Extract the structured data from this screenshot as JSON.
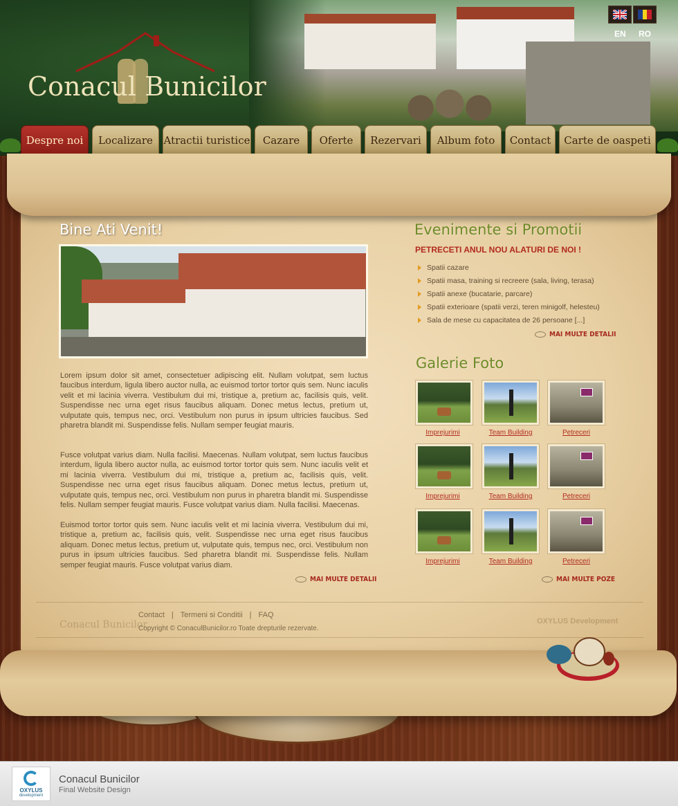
{
  "site": {
    "logo_text": "Conacul Bunicilor"
  },
  "languages": [
    {
      "code": "EN",
      "flag": "uk-flag-icon"
    },
    {
      "code": "RO",
      "flag": "romania-flag-icon"
    }
  ],
  "nav": {
    "items": [
      {
        "label": "Despre noi",
        "active": true
      },
      {
        "label": "Localizare",
        "active": false
      },
      {
        "label": "Atractii turistice",
        "active": false
      },
      {
        "label": "Cazare",
        "active": false
      },
      {
        "label": "Oferte",
        "active": false
      },
      {
        "label": "Rezervari",
        "active": false
      },
      {
        "label": "Album foto",
        "active": false
      },
      {
        "label": "Contact",
        "active": false
      },
      {
        "label": "Carte de oaspeti",
        "active": false
      }
    ]
  },
  "welcome": {
    "title": "Bine Ati Venit!",
    "paragraphs": [
      "Lorem ipsum dolor sit amet, consectetuer adipiscing elit. Nullam volutpat, sem luctus faucibus interdum, ligula libero auctor nulla, ac euismod tortor tortor quis sem. Nunc iaculis velit et mi lacinia viverra. Vestibulum dui mi, tristique a, pretium ac, facilisis quis, velit. Suspendisse nec urna eget risus faucibus aliquam. Donec metus lectus, pretium ut, vulputate quis, tempus nec, orci. Vestibulum non purus in ipsum ultricies faucibus. Sed pharetra blandit mi. Suspendisse felis. Nullam semper feugiat mauris.",
      "Fusce volutpat varius diam. Nulla facilisi. Maecenas.  Nullam volutpat, sem luctus faucibus interdum, ligula libero auctor nulla, ac euismod tortor tortor quis sem. Nunc iaculis velit et mi lacinia viverra. Vestibulum dui mi, tristique a, pretium ac, facilisis quis, velit. Suspendisse nec urna eget risus faucibus aliquam. Donec metus lectus, pretium ut, vulputate quis, tempus nec, orci. Vestibulum non purus in pharetra blandit mi. Suspendisse felis. Nullam semper feugiat mauris. Fusce volutpat varius diam. Nulla facilisi. Maecenas.",
      "Euismod tortor tortor quis sem. Nunc iaculis velit et mi lacinia viverra. Vestibulum dui mi, tristique a, pretium ac, facilisis quis, velit. Suspendisse nec urna eget risus faucibus aliquam. Donec metus lectus, pretium ut, vulputate quis, tempus nec, orci. Vestibulum non purus in ipsum ultricies faucibus. Sed pharetra blandit mi. Suspendisse felis. Nullam semper feugiat mauris. Fusce volutpat varius diam."
    ],
    "more_label": "MAI MULTE DETALII"
  },
  "events": {
    "title": "Evenimente si Promotii",
    "subtitle": "PETRECETI ANUL NOU ALATURI DE NOI !",
    "items": [
      "Spatii cazare",
      "Spatii masa, training si recreere (sala, living, terasa)",
      "Spatii anexe (bucatarie, parcare)",
      "Spatii exterioare (spatii verzi, teren minigolf, helesteu)",
      "Sala de mese cu capacitatea de 26 persoane  [...]"
    ],
    "more_label": "MAI MULTE DETALII"
  },
  "gallery": {
    "title": "Galerie Foto",
    "rows": [
      [
        {
          "label": "Imprejurimi",
          "kind": "cow"
        },
        {
          "label": "Team Building",
          "kind": "team"
        },
        {
          "label": "Petreceri",
          "kind": "party"
        }
      ],
      [
        {
          "label": "Imprejurimi",
          "kind": "cow"
        },
        {
          "label": "Team Building",
          "kind": "team"
        },
        {
          "label": "Petreceri",
          "kind": "party"
        }
      ],
      [
        {
          "label": "Imprejurimi",
          "kind": "cow"
        },
        {
          "label": "Team Building",
          "kind": "team"
        },
        {
          "label": "Petreceri",
          "kind": "party"
        }
      ]
    ],
    "more_label": "MAI MULTE POZE"
  },
  "footer": {
    "logo_text": "Conacul Bunicilor",
    "links": [
      "Contact",
      "Termeni si Conditii",
      "FAQ"
    ],
    "separator": "|",
    "copyright": "Copyright © ConaculBunicilor.ro  Toate drepturile rezervate.",
    "dev_watermark": "OXYLUS Development"
  },
  "presentation": {
    "badge_name": "OXYLUS",
    "badge_sub": "development",
    "title": "Conacul  Bunicilor",
    "subtitle": "Final  Website  Design"
  },
  "colors": {
    "accent_red": "#b12a1e",
    "title_green": "#6e8a28",
    "body_text": "#5e4c34",
    "nav_active": "#8e1f18"
  }
}
